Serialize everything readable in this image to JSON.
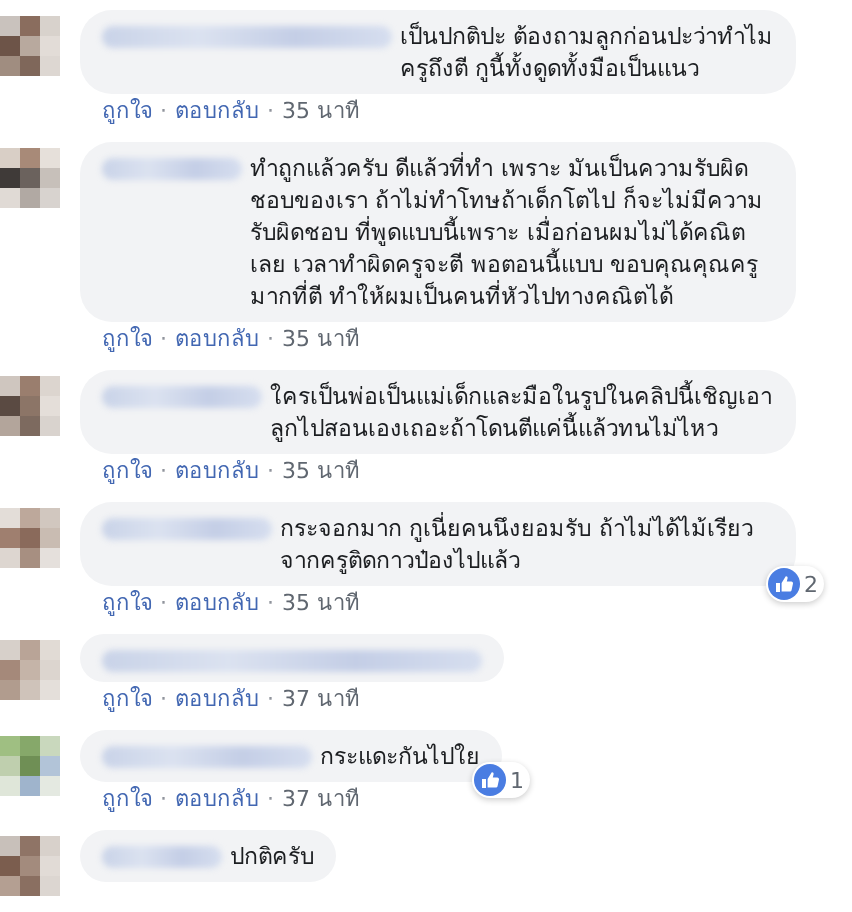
{
  "separator": "·",
  "comments": [
    {
      "text": "เป็นปกติปะ ต้องถามลูกก่อนปะว่าทำไมครูถึงตี กูนี้ทั้งดูดทั้งมือเป็นแนว",
      "actions": [
        "ถูกใจ",
        "ตอบกลับ",
        "35 นาที"
      ]
    },
    {
      "text": "ทำถูกแล้วครับ ดีแล้วที่ทำ เพราะ มันเป็นความรับผิดชอบของเรา ถ้าไม่ทำโทษถ้าเด็กโตไป ก็จะไม่มีความรับผิดชอบ ที่พูดแบบนี้เพราะ เมื่อก่อนผมไม่ได้คณิตเลย เวลาทำผิดครูจะตี พอตอนนี้แบบ ขอบคุณคุณครูมากที่ตี ทำให้ผมเป็นคนที่หัวไปทางคณิตได้",
      "actions": [
        "ถูกใจ",
        "ตอบกลับ",
        "35 นาที"
      ]
    },
    {
      "text": "ใครเป็นพ่อเป็นแม่เด็กและมือในรูปในคลิปนี้เชิญเอาลูกไปสอนเองเถอะถ้าโดนตีแค่นี้แล้วทนไม่ไหว",
      "actions": [
        "ถูกใจ",
        "ตอบกลับ",
        "35 นาที"
      ]
    },
    {
      "text": "กระจอกมาก กูเนี่ยคนนึงยอมรับ ถ้าไม่ได้ไม้เรียวจากครูติดกาวป๋องไปแล้ว",
      "actions": [
        "ถูกใจ",
        "ตอบกลับ",
        "35 นาที"
      ],
      "likes": "2"
    },
    {
      "actions": [
        "ถูกใจ",
        "ตอบกลับ",
        "37 นาที"
      ]
    },
    {
      "text": "กระแดะกันไปใย",
      "actions": [
        "ถูกใจ",
        "ตอบกลับ",
        "37 นาที"
      ],
      "likes": "1"
    },
    {
      "text": "ปกติครับ"
    }
  ]
}
